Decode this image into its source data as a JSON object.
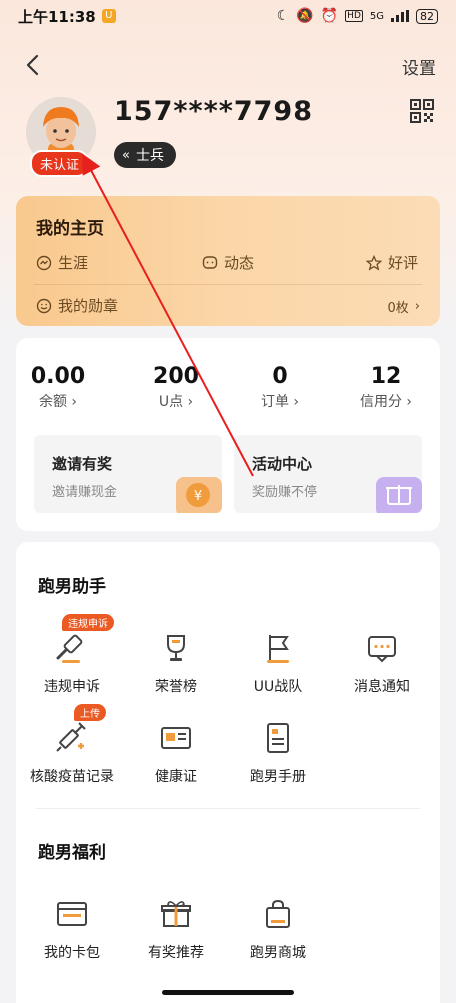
{
  "status_bar": {
    "time": "上午11:38",
    "network": "5G",
    "battery": "82"
  },
  "header": {
    "settings_label": "设置"
  },
  "profile": {
    "phone": "157****7798",
    "rank": "士兵",
    "verify_badge": "未认证"
  },
  "home_card": {
    "title": "我的主页",
    "items": [
      "生涯",
      "动态",
      "好评"
    ],
    "medal_label": "我的勋章",
    "medal_count": "0枚"
  },
  "stats": [
    {
      "value": "0.00",
      "label": "余额"
    },
    {
      "value": "200",
      "label": "U点"
    },
    {
      "value": "0",
      "label": "订单"
    },
    {
      "value": "12",
      "label": "信用分"
    }
  ],
  "promos": [
    {
      "title": "邀请有奖",
      "subtitle": "邀请赚现金"
    },
    {
      "title": "活动中心",
      "subtitle": "奖励赚不停"
    }
  ],
  "assistant": {
    "title": "跑男助手",
    "tools": [
      {
        "label": "违规申诉",
        "tag": "违规申诉",
        "icon": "gavel-icon"
      },
      {
        "label": "荣誉榜",
        "icon": "trophy-icon"
      },
      {
        "label": "UU战队",
        "icon": "flag-icon"
      },
      {
        "label": "消息通知",
        "icon": "message-icon"
      },
      {
        "label": "核酸疫苗记录",
        "tag": "上传",
        "icon": "syringe-icon"
      },
      {
        "label": "健康证",
        "icon": "id-card-icon"
      },
      {
        "label": "跑男手册",
        "icon": "handbook-icon"
      }
    ]
  },
  "welfare": {
    "title": "跑男福利",
    "tools": [
      {
        "label": "我的卡包",
        "icon": "wallet-icon"
      },
      {
        "label": "有奖推荐",
        "icon": "gift-icon"
      },
      {
        "label": "跑男商城",
        "icon": "shopping-bag-icon"
      }
    ]
  },
  "colors": {
    "accent": "#f5a24a",
    "badge_red": "#e8361d",
    "tag_orange": "#ec5a24",
    "annotation": "#e8201d"
  }
}
